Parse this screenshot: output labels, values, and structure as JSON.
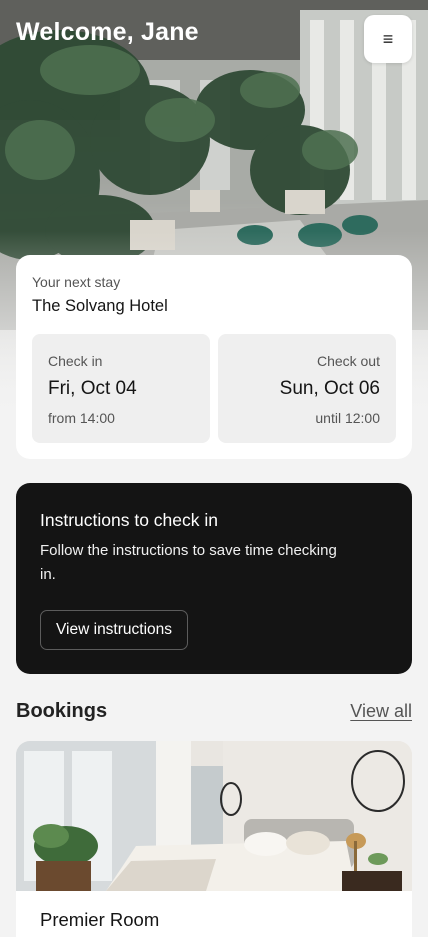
{
  "header": {
    "welcome": "Welcome, Jane",
    "menu_icon": "≡"
  },
  "next_stay": {
    "label": "Your next stay",
    "hotel": "The Solvang Hotel",
    "check_in": {
      "title": "Check in",
      "date": "Fri, Oct 04",
      "time": "from 14:00"
    },
    "check_out": {
      "title": "Check out",
      "date": "Sun, Oct 06",
      "time": "until 12:00"
    }
  },
  "instructions": {
    "title": "Instructions to check in",
    "text": "Follow the instructions to save time checking in.",
    "button": "View instructions"
  },
  "bookings": {
    "title": "Bookings",
    "view_all": "View all",
    "items": [
      {
        "name": "Premier Room"
      }
    ]
  },
  "colors": {
    "dark_card": "#141414",
    "card": "#ffffff",
    "background": "#f3f3f3"
  }
}
